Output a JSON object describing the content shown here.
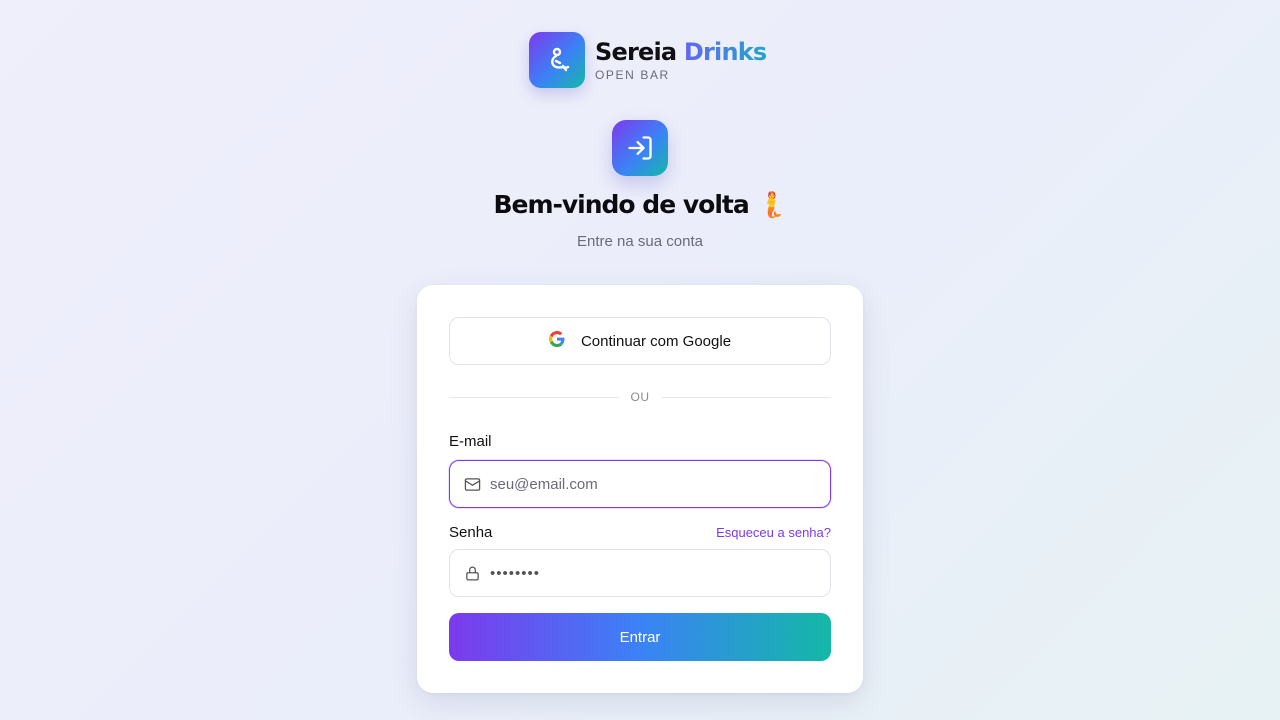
{
  "brand": {
    "name_part1": "Sereia",
    "name_part2": "Drinks",
    "tagline": "OPEN BAR",
    "logo_icon": "mermaid-logo-icon"
  },
  "header": {
    "title": "Bem-vindo de volta 🧜",
    "subtitle": "Entre na sua conta",
    "icon": "login-icon"
  },
  "login_form": {
    "google_button": "Continuar com Google",
    "divider": "OU",
    "email_label": "E-mail",
    "email_placeholder": "seu@email.com",
    "email_value": "",
    "password_label": "Senha",
    "password_value": "••••••••",
    "forgot_link": "Esqueceu a senha?",
    "submit_button": "Entrar"
  },
  "colors": {
    "accent": "#7c3aed",
    "gradient_start": "#7c3aed",
    "gradient_mid": "#3b82f6",
    "gradient_end": "#14b8a6"
  }
}
